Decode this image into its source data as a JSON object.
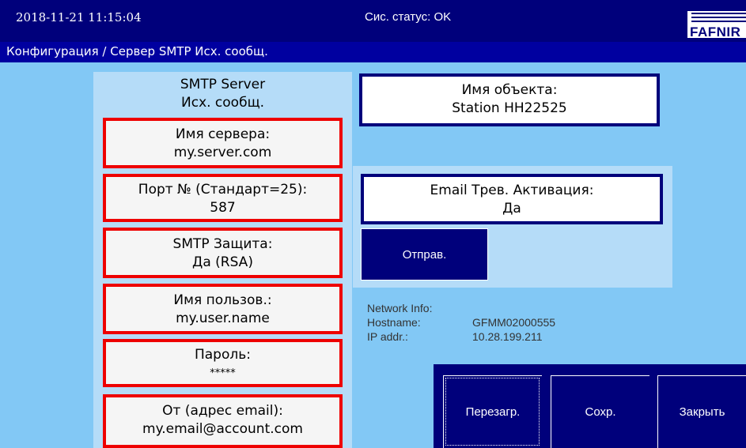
{
  "header": {
    "datetime": "2018-11-21  11:15:04",
    "status": "Сис. статус: OK",
    "logo_text": "FAFNIR"
  },
  "breadcrumb": "Конфигурация / Сервер SMTP Исх. сообщ.",
  "smtp": {
    "title_line1": "SMTP Server",
    "title_line2": "Исх. сообщ.",
    "fields": [
      {
        "label": "Имя сервера:",
        "value": "my.server.com"
      },
      {
        "label": "Порт № (Стандарт=25):",
        "value": "587"
      },
      {
        "label": "SMTP Защита:",
        "value": "Да (RSA)"
      },
      {
        "label": "Имя пользов.:",
        "value": "my.user.name"
      },
      {
        "label": "Пароль:",
        "value": "*****"
      },
      {
        "label": "От (адрес email):",
        "value": "my.email@account.com"
      }
    ]
  },
  "object": {
    "label": "Имя объекта:",
    "value": "Station HH22525"
  },
  "email_alarm": {
    "label": "Email Трев. Активация:",
    "value": "Да"
  },
  "send_button": "Отправ.",
  "network": {
    "title": "Network Info:",
    "hostname_label": "Hostname:",
    "hostname": "GFMM02000555",
    "ip_label": "IP addr.:",
    "ip": "10.28.199.211"
  },
  "buttons": {
    "reboot": "Перезагр.",
    "save": "Сохр.",
    "close": "Закрыть"
  },
  "colors": {
    "header_bg": "#00007b",
    "field_border": "#ee0000",
    "box_border": "#00007b",
    "panel_bg": "#82c8f5"
  }
}
